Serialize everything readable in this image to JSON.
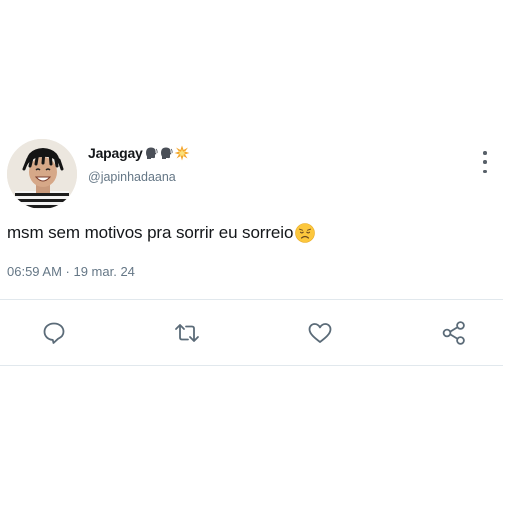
{
  "tweet": {
    "author": {
      "display_name": "Japagay",
      "name_emojis": [
        "speaking-head-emoji",
        "speaking-head-emoji",
        "collision-emoji"
      ],
      "handle": "@japinhadaana"
    },
    "text": "msm sem motivos pra sorrir eu sorreio",
    "text_emoji": "disappointed-face-emoji",
    "timestamp": "06:59 AM · 19 mar. 24"
  },
  "actions": {
    "reply_icon": "reply-icon",
    "retweet_icon": "retweet-icon",
    "like_icon": "heart-icon",
    "share_icon": "share-icon",
    "more_icon": "more-vertical-icon"
  },
  "colors": {
    "text_primary": "#14171a",
    "text_secondary": "#657786",
    "icon": "#5b6b78",
    "divider": "#e1e8ed"
  }
}
